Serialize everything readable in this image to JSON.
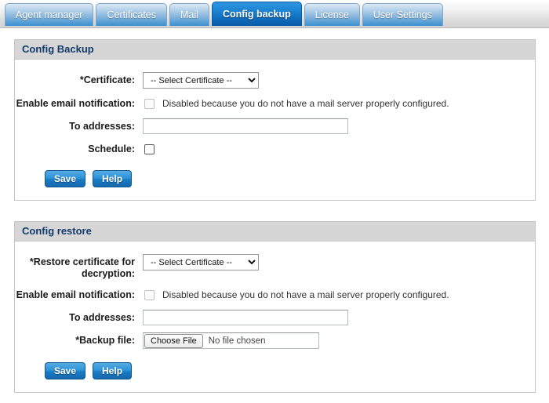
{
  "tabs": [
    {
      "label": "Agent manager",
      "active": false
    },
    {
      "label": "Certificates",
      "active": false
    },
    {
      "label": "Mail",
      "active": false
    },
    {
      "label": "Config backup",
      "active": true
    },
    {
      "label": "License",
      "active": false
    },
    {
      "label": "User Settings",
      "active": false
    }
  ],
  "backup_panel": {
    "title": "Config Backup",
    "certificate_label": "*Certificate:",
    "certificate_value": "-- Select Certificate --",
    "email_label": "Enable email notification:",
    "email_hint": "Disabled because you do not have a mail server properly configured.",
    "to_addresses_label": "To addresses:",
    "to_addresses_value": "",
    "to_addresses_placeholder": "",
    "schedule_label": "Schedule:",
    "save_label": "Save",
    "help_label": "Help"
  },
  "restore_panel": {
    "title": "Config restore",
    "certificate_label": "*Restore certificate for decryption:",
    "certificate_value": "-- Select Certificate --",
    "email_label": "Enable email notification:",
    "email_hint": "Disabled because you do not have a mail server properly configured.",
    "to_addresses_label": "To addresses:",
    "to_addresses_value": "",
    "to_addresses_placeholder": "",
    "backup_file_label": "*Backup file:",
    "choose_file_label": "Choose File",
    "no_file_label": "No file chosen",
    "save_label": "Save",
    "help_label": "Help"
  },
  "colors": {
    "active_tab": "#0f6cbc",
    "panel_header_text": "#123a6b",
    "panel_header_bg": "#d6d6d6",
    "button_blue": "#1a7cc4"
  }
}
